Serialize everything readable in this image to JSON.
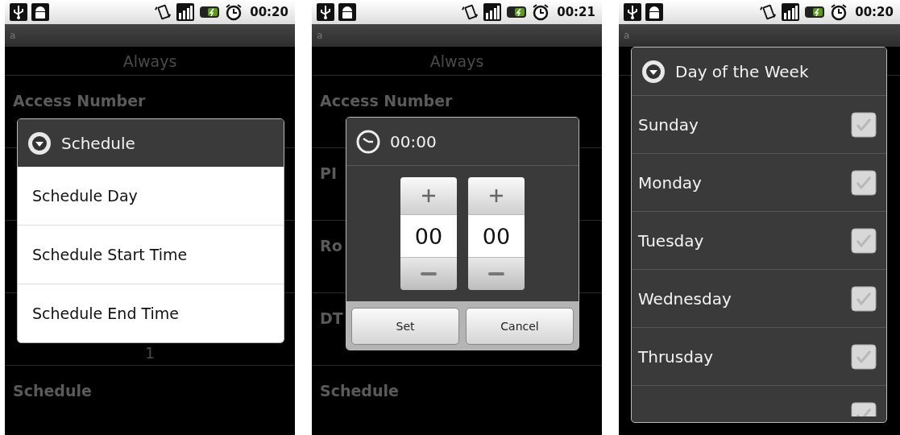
{
  "phones": [
    {
      "status": {
        "time": "00:20"
      },
      "title_bar": "a",
      "top_value": "Always",
      "rows": [
        {
          "title": "Access Number"
        },
        {},
        {},
        {
          "value": "1"
        },
        {
          "title": "Schedule"
        }
      ],
      "dialog": {
        "kind": "menu",
        "title": "Schedule",
        "items": [
          {
            "label": "Schedule Day"
          },
          {
            "label": "Schedule Start Time"
          },
          {
            "label": "Schedule End Time"
          }
        ]
      }
    },
    {
      "status": {
        "time": "00:21"
      },
      "title_bar": "a",
      "top_value": "Always",
      "rows": [
        {
          "title": "Access Number"
        },
        {
          "title": "PI"
        },
        {
          "title": "Ro"
        },
        {
          "title": "DT"
        },
        {
          "title": "Schedule"
        }
      ],
      "dialog": {
        "kind": "time_picker",
        "title": "00:00",
        "columns": [
          {
            "value": "00"
          },
          {
            "value": "00"
          }
        ],
        "buttons": [
          "Set",
          "Cancel"
        ]
      }
    },
    {
      "status": {
        "time": "00:20"
      },
      "title_bar": "a",
      "dialog": {
        "kind": "multi_choice",
        "title": "Day of the Week",
        "items": [
          {
            "label": "Sunday",
            "checked": false
          },
          {
            "label": "Monday",
            "checked": false
          },
          {
            "label": "Tuesday",
            "checked": false
          },
          {
            "label": "Wednesday",
            "checked": false
          },
          {
            "label": "Thrusday",
            "checked": false
          },
          {
            "checked": false
          }
        ]
      }
    }
  ]
}
